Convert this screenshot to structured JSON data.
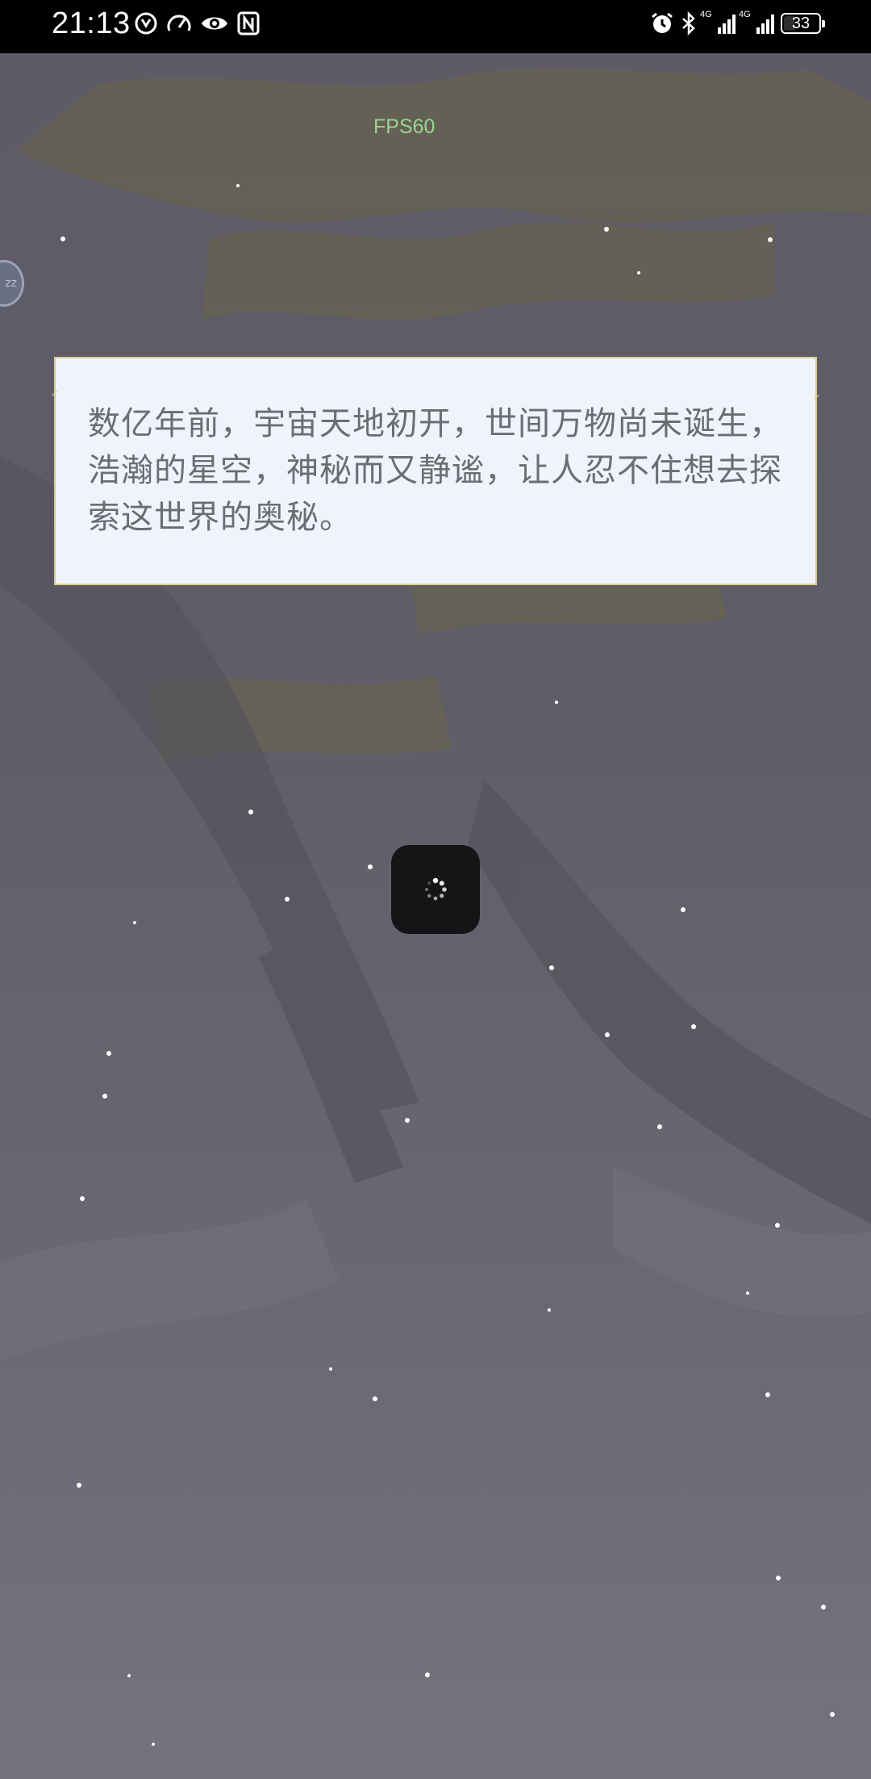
{
  "status_bar": {
    "time": "21:13",
    "left_icons": [
      "game-accelerator-icon",
      "speed-gauge-icon",
      "eye-icon",
      "nfc-icon"
    ],
    "network_1": "4G",
    "network_2": "4G",
    "battery": "33"
  },
  "overlay": {
    "fps": "FPS60",
    "float_bubble": "zz"
  },
  "dialog": {
    "text": "数亿年前，宇宙天地初开，世间万物尚未诞生，浩瀚的星空，神秘而又静谧，让人忍不住想去探索这世界的奥秘。"
  },
  "loader": {
    "state": "loading"
  },
  "colors": {
    "fps": "#9bd58f",
    "dialog_bg": "#eff4fc",
    "dialog_border": "#d8c98f",
    "dialog_text": "#6b6d73",
    "loader_bg": "#151517"
  }
}
